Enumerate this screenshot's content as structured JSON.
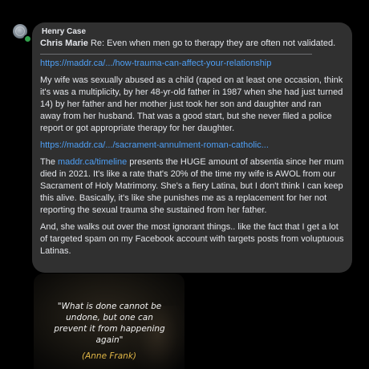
{
  "message": {
    "sender_name": "Henry Case",
    "reply": {
      "quoted_author": "Chris Marie",
      "quoted_text": "Re: Even when men go to therapy they are often not validated."
    },
    "link1": "https://maddr.ca/.../how-trauma-can-affect-your-relationship",
    "paragraph1": "My wife was sexually abused as a child (raped on at least one occasion, think it's was a multiplicity, by her 48-yr-old father in 1987 when she had just turned 14) by her father and her mother just took her son and daughter and ran away from her husband. That was a good start, but she never filed a police report or got appropriate therapy for her daughter.",
    "link2": "https://maddr.ca/.../sacrament-annulment-roman-catholic...",
    "paragraph2": {
      "prefix": "The ",
      "link": "maddr.ca/timeline",
      "rest": " presents the HUGE amount of absentia since her mum died in 2021. It's like a rate that's 20% of the time my wife is AWOL from our Sacrament of Holy Matrimony. She's a fiery Latina, but I don't think I can keep this alive. Basically, it's like she punishes me as a replacement for her not reporting the sexual trauma she sustained from her father."
    },
    "paragraph3": "And, she walks out over the most ignorant things.. like the fact that I get a lot of targeted spam on my Facebook account with targets posts from voluptuous Latinas."
  },
  "image_card": {
    "quote": "\"What is done cannot be undone, but one can prevent it from happening again\"",
    "author": "(Anne Frank)"
  },
  "colors": {
    "background": "#000000",
    "bubble": "#303030",
    "text": "#e4e6eb",
    "link": "#4e9ff5",
    "online_status": "#31a24c",
    "quote_author": "#e0b646"
  },
  "icons": {
    "avatar": "profile-photo",
    "status": "online-dot"
  }
}
